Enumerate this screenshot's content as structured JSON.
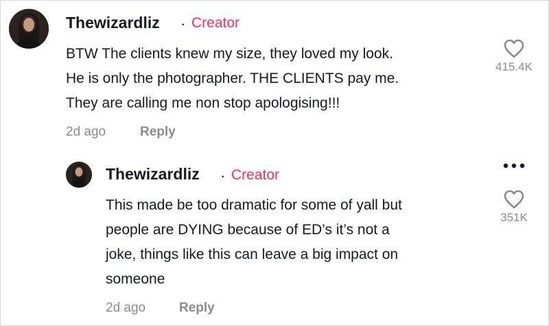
{
  "comment": {
    "username": "Thewizardliz",
    "separator": "·",
    "badge": "Creator",
    "avatar_icon": "profile-photo",
    "lines": [
      "BTW The clients knew my size, they loved my look.",
      "He is only the photographer. THE CLIENTS pay me.",
      "They are calling me non stop apologising!!!"
    ],
    "time": "2d ago",
    "reply_label": "Reply",
    "like_icon": "heart-outline-icon",
    "like_count": "415.4K"
  },
  "reply": {
    "username": "Thewizardliz",
    "separator": "·",
    "badge": "Creator",
    "avatar_icon": "profile-photo",
    "lines": [
      "This made be too dramatic for some of yall but",
      "people are DYING because of ED’s it’s not a",
      "joke, things like this can leave a big impact on",
      "someone"
    ],
    "time": "2d ago",
    "reply_label": "Reply",
    "like_icon": "heart-outline-icon",
    "like_count": "351K",
    "more_icon": "more-options-icon"
  },
  "colors": {
    "accent": "#fe2c55",
    "text": "#161823",
    "muted": "#8a8b91"
  }
}
